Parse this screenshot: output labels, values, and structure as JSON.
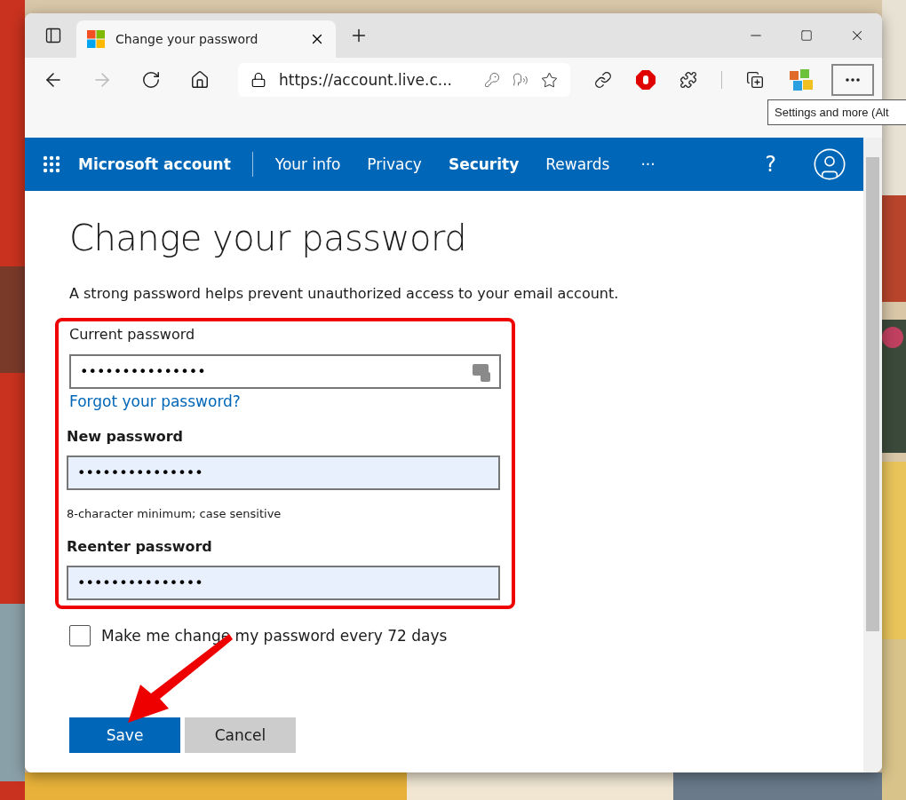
{
  "browser": {
    "tab": {
      "title": "Change your password"
    },
    "address": "https://account.live.c...",
    "tooltip": "Settings and more (Alt"
  },
  "nav": {
    "brand": "Microsoft account",
    "items": [
      {
        "label": "Your info",
        "selected": false
      },
      {
        "label": "Privacy",
        "selected": false
      },
      {
        "label": "Security",
        "selected": true
      },
      {
        "label": "Rewards",
        "selected": false
      }
    ],
    "more": "···",
    "help": "?"
  },
  "page": {
    "title": "Change your password",
    "intro": "A strong password helps prevent unauthorized access to your email account.",
    "fields": [
      {
        "kind": "current",
        "label": "Current password",
        "value": "•••••••••••••••",
        "link": "Forgot your password?"
      },
      {
        "kind": "new",
        "label": "New password",
        "value": "•••••••••••••••",
        "hint": "8-character minimum; case sensitive"
      },
      {
        "kind": "new",
        "label": "Reenter password",
        "value": "•••••••••••••••"
      }
    ],
    "checkbox": {
      "label": "Make me change my password every 72 days",
      "checked": false
    },
    "buttons": [
      {
        "kind": "primary",
        "label": "Save"
      },
      {
        "kind": "secondary",
        "label": "Cancel"
      }
    ]
  }
}
